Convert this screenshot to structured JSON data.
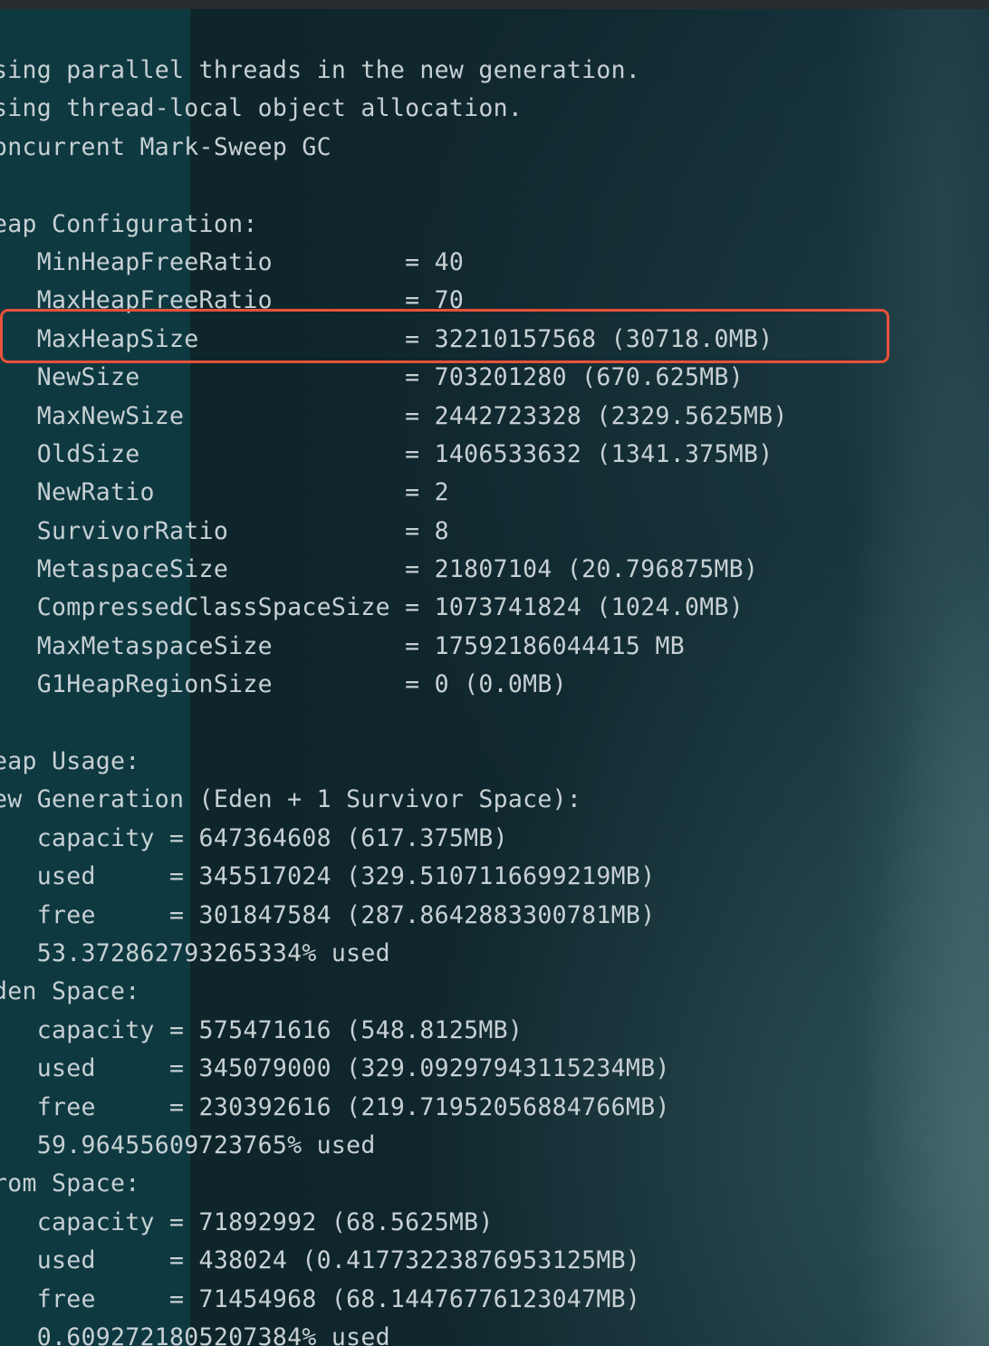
{
  "terminal": {
    "lines": [
      "sing parallel threads in the new generation.",
      "sing thread-local object allocation.",
      "oncurrent Mark-Sweep GC",
      "",
      "eap Configuration:",
      "   MinHeapFreeRatio         = 40",
      "   MaxHeapFreeRatio         = 70",
      "   MaxHeapSize              = 32210157568 (30718.0MB)",
      "   NewSize                  = 703201280 (670.625MB)",
      "   MaxNewSize               = 2442723328 (2329.5625MB)",
      "   OldSize                  = 1406533632 (1341.375MB)",
      "   NewRatio                 = 2",
      "   SurvivorRatio            = 8",
      "   MetaspaceSize            = 21807104 (20.796875MB)",
      "   CompressedClassSpaceSize = 1073741824 (1024.0MB)",
      "   MaxMetaspaceSize         = 17592186044415 MB",
      "   G1HeapRegionSize         = 0 (0.0MB)",
      "",
      "eap Usage:",
      "ew Generation (Eden + 1 Survivor Space):",
      "   capacity = 647364608 (617.375MB)",
      "   used     = 345517024 (329.5107116699219MB)",
      "   free     = 301847584 (287.8642883300781MB)",
      "   53.372862793265334% used",
      "den Space:",
      "   capacity = 575471616 (548.8125MB)",
      "   used     = 345079000 (329.09297943115234MB)",
      "   free     = 230392616 (219.71952056884766MB)",
      "   59.96455609723765% used",
      "rom Space:",
      "   capacity = 71892992 (68.5625MB)",
      "   used     = 438024 (0.41773223876953125MB)",
      "   free     = 71454968 (68.14476776123047MB)",
      "   0.6092721805207384% used"
    ]
  },
  "colors": {
    "text": "#c7d0d3",
    "highlight_border": "#e8513a",
    "left_panel": "#0f3a42",
    "background": "#0d2529"
  }
}
